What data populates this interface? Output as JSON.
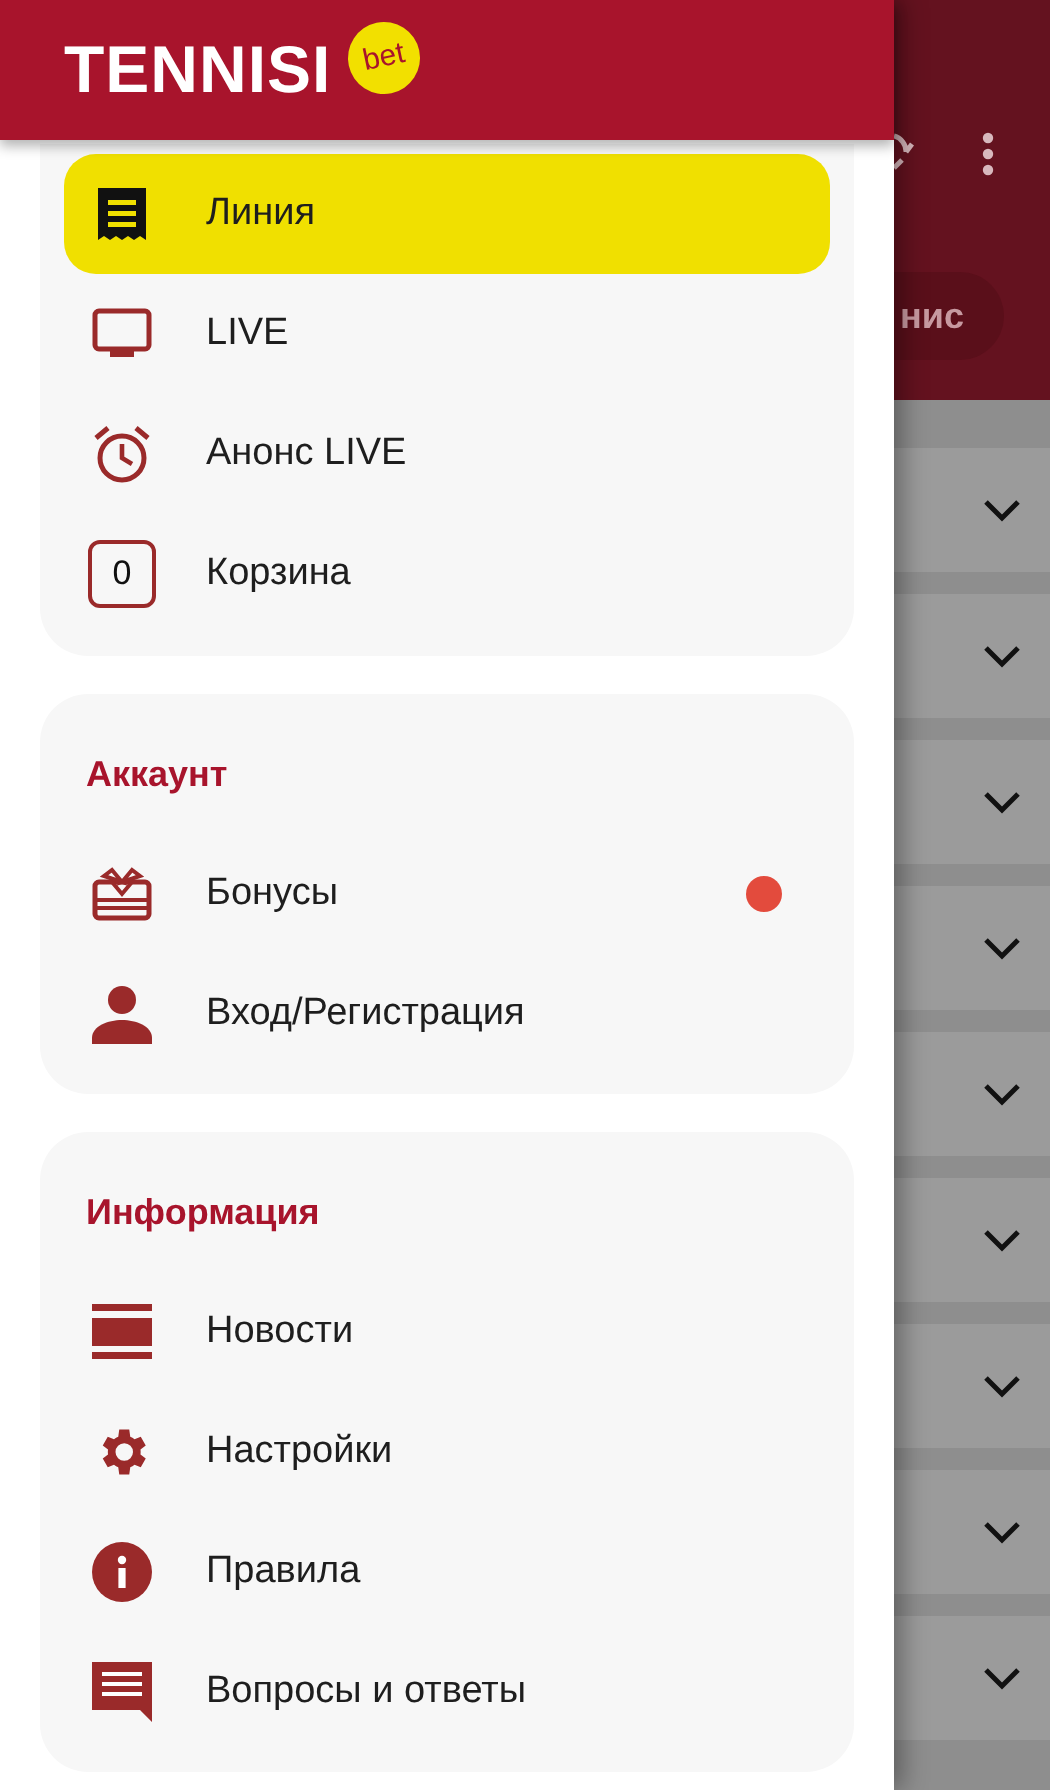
{
  "logo": {
    "name": "TENNISI",
    "badge": "bet"
  },
  "background": {
    "tab": "нис"
  },
  "sections": [
    {
      "items": [
        {
          "label": "Линия",
          "kind": "ticket",
          "selected": true
        },
        {
          "label": "LIVE",
          "kind": "tv",
          "selected": false
        },
        {
          "label": "Анонс LIVE",
          "kind": "alarm",
          "selected": false
        },
        {
          "label": "Корзина",
          "kind": "basket",
          "count": "0",
          "selected": false
        }
      ]
    },
    {
      "title": "Аккаунт",
      "items": [
        {
          "label": "Бонусы",
          "kind": "gift",
          "selected": false,
          "dot": true
        },
        {
          "label": "Вход/Регистрация",
          "kind": "person",
          "selected": false
        }
      ]
    },
    {
      "title": "Информация",
      "items": [
        {
          "label": "Новости",
          "kind": "news",
          "selected": false
        },
        {
          "label": "Настройки",
          "kind": "settings",
          "selected": false
        },
        {
          "label": "Правила",
          "kind": "info",
          "selected": false
        },
        {
          "label": "Вопросы и ответы",
          "kind": "chat",
          "selected": false
        }
      ]
    }
  ]
}
